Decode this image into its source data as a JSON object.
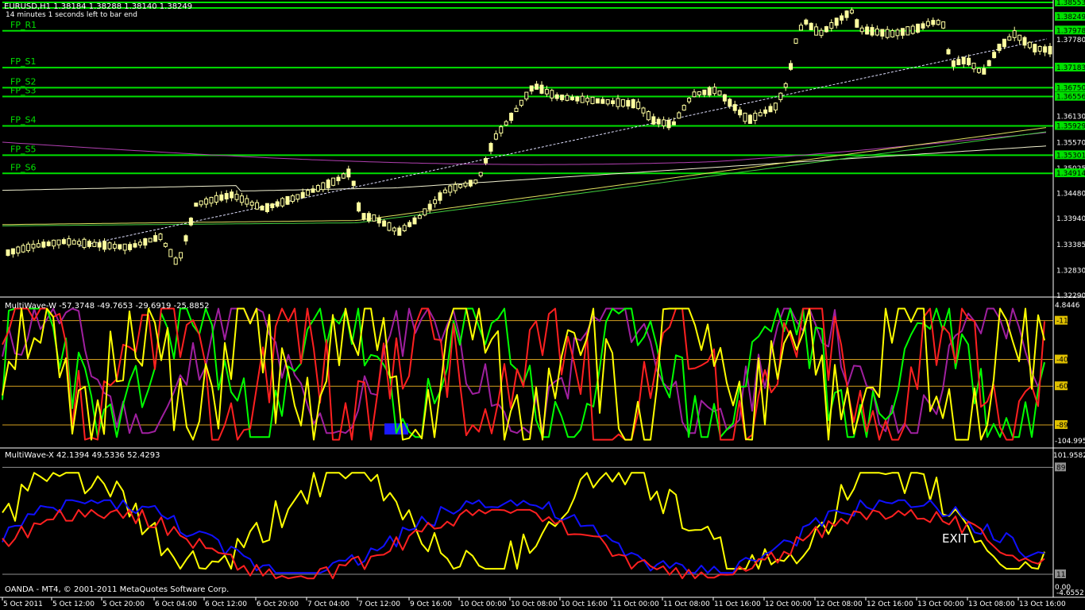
{
  "main": {
    "header": "EURUSD,H1  1.38184 1.38288 1.38140 1.38249",
    "timer": "14 minutes 1 seconds left to bar end",
    "y_min": 1.3229,
    "y_max": 1.3858,
    "price_ticks": [
      {
        "value": 1.3858,
        "label": "1.38553"
      },
      {
        "value": 1.3827,
        "label": "1.38249"
      },
      {
        "value": 1.37978,
        "label": "1.37978"
      },
      {
        "value": 1.3778,
        "label": "1.37780"
      },
      {
        "value": 1.37183,
        "label": "1.37183"
      },
      {
        "value": 1.3675,
        "label": "1.36750"
      },
      {
        "value": 1.36556,
        "label": "1.36556"
      },
      {
        "value": 1.3613,
        "label": "1.36130"
      },
      {
        "value": 1.35929,
        "label": "1.35929"
      },
      {
        "value": 1.3557,
        "label": "1.35570"
      },
      {
        "value": 1.35301,
        "label": "1.35301"
      },
      {
        "value": 1.3502,
        "label": "1.35025"
      },
      {
        "value": 1.34914,
        "label": "1.34914"
      },
      {
        "value": 1.3448,
        "label": "1.34480"
      },
      {
        "value": 1.3394,
        "label": "1.33940"
      },
      {
        "value": 1.3338,
        "label": "1.33385"
      },
      {
        "value": 1.3283,
        "label": "1.32830"
      },
      {
        "value": 1.3229,
        "label": "1.32290"
      }
    ],
    "green_labels": [
      "1.38553",
      "1.38249",
      "1.37978",
      "1.37183",
      "1.36750",
      "1.36556",
      "1.35929",
      "1.35301",
      "1.34914"
    ],
    "pivot_levels": [
      {
        "name": "",
        "value": 1.3858
      },
      {
        "name": "",
        "value": 1.3846
      },
      {
        "name": "FP_R1",
        "value": 1.3797
      },
      {
        "name": "FP_S1",
        "value": 1.3718
      },
      {
        "name": "FP_S2",
        "value": 1.3675
      },
      {
        "name": "FP_S3",
        "value": 1.3656
      },
      {
        "name": "FP_S4",
        "value": 1.3593
      },
      {
        "name": "FP_S5",
        "value": 1.353
      },
      {
        "name": "FP_S6",
        "value": 1.3491
      }
    ]
  },
  "wave_w": {
    "header": "MultiWave-W -57.3748 -49.7653 -29.6919 -25.8852",
    "top_label": "4.8446",
    "bottom_label": "-104.995",
    "levels": [
      {
        "label": "-11",
        "value": -11
      },
      {
        "label": "-40",
        "value": -40
      },
      {
        "label": "-60",
        "value": -60
      },
      {
        "label": "-89",
        "value": -89
      }
    ]
  },
  "wave_x": {
    "header": "MultiWave-X 42.1394 49.5336 52.4293",
    "top_label": "101.9582",
    "bottom_label": "-4.6552",
    "zero_label": "0.00",
    "levels": [
      {
        "label": "89",
        "value": 89
      },
      {
        "label": "11",
        "value": 11
      }
    ],
    "exit_label": "EXIT"
  },
  "footer": "OANDA - MT4, © 2001-2011 MetaQuotes Software Corp.",
  "time_labels": [
    "5 Oct 2011",
    "5 Oct 12:00",
    "5 Oct 20:00",
    "6 Oct 04:00",
    "6 Oct 12:00",
    "6 Oct 20:00",
    "7 Oct 04:00",
    "7 Oct 12:00",
    "9 Oct 16:00",
    "10 Oct 00:00",
    "10 Oct 08:00",
    "10 Oct 16:00",
    "11 Oct 00:00",
    "11 Oct 08:00",
    "11 Oct 16:00",
    "12 Oct 00:00",
    "12 Oct 08:00",
    "12 Oct 16:00",
    "13 Oct 00:00",
    "13 Oct 08:00",
    "13 Oct 16:00"
  ],
  "colors": {
    "pivot": "#00e000",
    "candle": "#ffffa0",
    "red": "#ff2020",
    "yellow": "#ffff00",
    "green": "#00ff00",
    "purple": "#a020a0",
    "blue": "#1010ff",
    "grid": "#c8c8c8"
  },
  "chart_data": {
    "type": "line",
    "x": [
      "5 Oct 2011",
      "5 Oct 12:00",
      "5 Oct 20:00",
      "6 Oct 04:00",
      "6 Oct 12:00",
      "6 Oct 20:00",
      "7 Oct 04:00",
      "7 Oct 12:00",
      "9 Oct 16:00",
      "10 Oct 00:00",
      "10 Oct 08:00",
      "10 Oct 16:00",
      "11 Oct 00:00",
      "11 Oct 08:00",
      "11 Oct 16:00",
      "12 Oct 00:00",
      "12 Oct 08:00",
      "12 Oct 16:00",
      "13 Oct 00:00",
      "13 Oct 08:00",
      "13 Oct 16:00"
    ],
    "series": [
      {
        "name": "EURUSD",
        "values": [
          1.331,
          1.335,
          1.334,
          1.333,
          1.342,
          1.344,
          1.346,
          1.339,
          1.336,
          1.352,
          1.366,
          1.364,
          1.362,
          1.364,
          1.362,
          1.374,
          1.379,
          1.378,
          1.378,
          1.373,
          1.376
        ]
      }
    ]
  }
}
